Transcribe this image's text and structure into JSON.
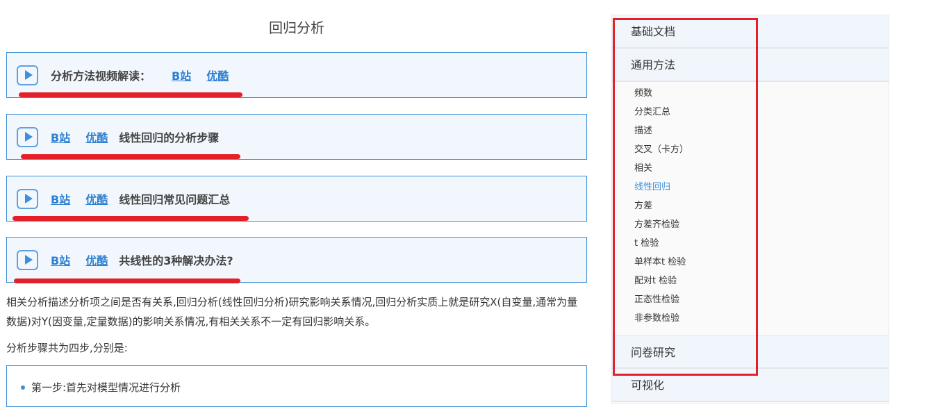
{
  "title": "回归分析",
  "video_boxes": [
    {
      "text": "分析方法视频解读：",
      "links": [
        "B站",
        "优酷"
      ],
      "text_first": true
    },
    {
      "text": "线性回归的分析步骤",
      "links": [
        "B站",
        "优酷"
      ]
    },
    {
      "text": "线性回归常见问题汇总",
      "links": [
        "B站",
        "优酷"
      ]
    },
    {
      "text": "共线性的3种解决办法?",
      "links": [
        "B站",
        "优酷"
      ]
    }
  ],
  "paragraph1": "相关分析描述分析项之间是否有关系,回归分析(线性回归分析)研究影响关系情况,回归分析实质上就是研究X(自变量,通常为量数据)对Y(因变量,定量数据)的影响关系情况,有相关关系不一定有回归影响关系。",
  "paragraph2": "分析步骤共为四步,分别是:",
  "steps": [
    "第一步:首先对模型情况进行分析"
  ],
  "sidebar": {
    "sections": [
      "基础文档",
      "通用方法",
      "问卷研究",
      "可视化"
    ],
    "items": [
      "频数",
      "分类汇总",
      "描述",
      "交叉（卡方）",
      "相关",
      "线性回归",
      "方差",
      "方差齐检验",
      "t 检验",
      "单样本t 检验",
      "配对t 检验",
      "正态性检验",
      "非参数检验"
    ],
    "active_item": "线性回归"
  },
  "colors": {
    "accent": "#3a8fd6",
    "annotation": "#e3202a"
  }
}
